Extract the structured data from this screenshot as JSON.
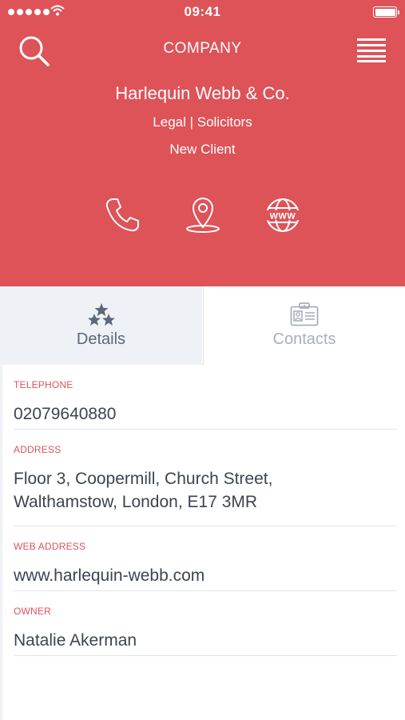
{
  "status_bar": {
    "time": "09:41"
  },
  "nav": {
    "title": "COMPANY",
    "search_icon": "search-icon",
    "menu_icon": "menu-icon"
  },
  "company": {
    "name": "Harlequin Webb & Co.",
    "sector": "Legal | Solicitors",
    "status": "New Client"
  },
  "actions": [
    {
      "icon": "phone-icon"
    },
    {
      "icon": "location-pin-icon"
    },
    {
      "icon": "globe-www-icon"
    }
  ],
  "tabs": [
    {
      "label": "Details",
      "icon": "stars-icon",
      "active": true
    },
    {
      "label": "Contacts",
      "icon": "id-card-icon",
      "active": false
    }
  ],
  "details": {
    "telephone": {
      "label": "TELEPHONE",
      "value": "02079640880"
    },
    "address": {
      "label": "ADDRESS",
      "value": "Floor 3, Coopermill, Church Street, Walthamstow, London, E17 3MR"
    },
    "web_address": {
      "label": "WEB ADDRESS",
      "value": "www.harlequin-webb.com"
    },
    "owner": {
      "label": "OWNER",
      "value": "Natalie Akerman"
    }
  },
  "colors": {
    "header_bg": "#dd5358",
    "accent_label": "#dd5358",
    "active_tab_bg": "#eef2f6",
    "text_primary": "#3d4450"
  }
}
